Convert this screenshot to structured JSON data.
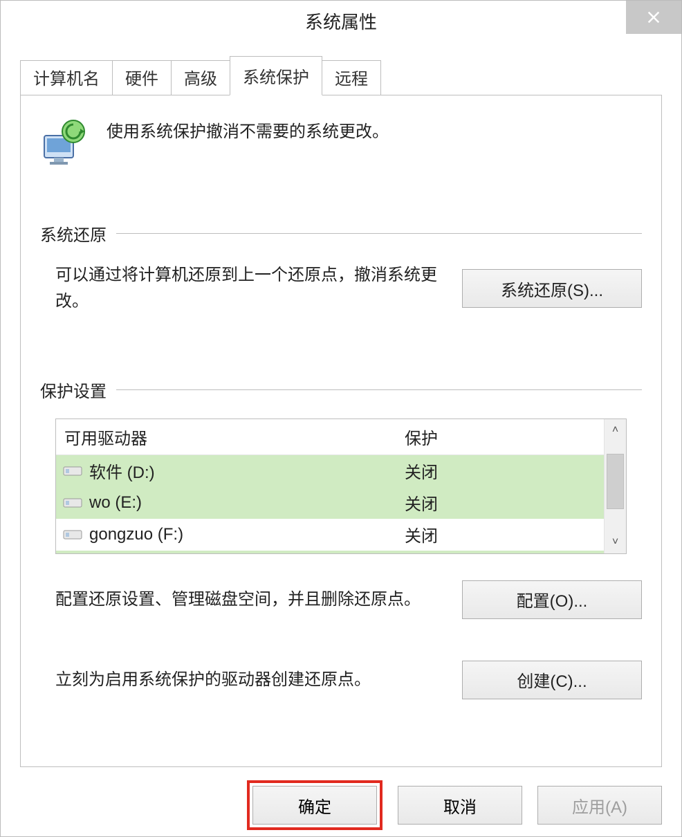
{
  "window": {
    "title": "系统属性"
  },
  "tabs": {
    "computer_name": "计算机名",
    "hardware": "硬件",
    "advanced": "高级",
    "system_protection": "系统保护",
    "remote": "远程"
  },
  "intro": {
    "text": "使用系统保护撤消不需要的系统更改。"
  },
  "sections": {
    "system_restore": {
      "label": "系统还原",
      "description": "可以通过将计算机还原到上一个还原点，撤消系统更改。",
      "button": "系统还原(S)..."
    },
    "protection_settings": {
      "label": "保护设置",
      "columns": {
        "drive": "可用驱动器",
        "protection": "保护"
      },
      "drives": [
        {
          "name": "软件 (D:)",
          "protection": "关闭"
        },
        {
          "name": "wo (E:)",
          "protection": "关闭"
        },
        {
          "name": "gongzuo (F:)",
          "protection": "关闭"
        }
      ],
      "configure": {
        "description": "配置还原设置、管理磁盘空间，并且删除还原点。",
        "button": "配置(O)..."
      },
      "create": {
        "description": "立刻为启用系统保护的驱动器创建还原点。",
        "button": "创建(C)..."
      }
    }
  },
  "footer": {
    "ok": "确定",
    "cancel": "取消",
    "apply": "应用(A)"
  }
}
